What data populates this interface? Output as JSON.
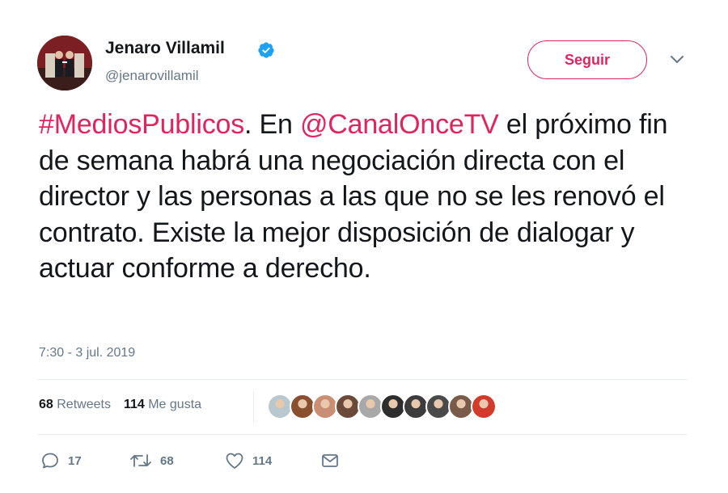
{
  "author": {
    "name": "Jenaro Villamil",
    "handle": "@jenarovillamil",
    "verified": true,
    "avatar_icon": "avatar-photo"
  },
  "follow_button": {
    "label": "Seguir",
    "color": "#e0245e"
  },
  "tweet": {
    "segments": [
      {
        "text": "#MediosPublicos",
        "type": "hashtag"
      },
      {
        "text": ". En ",
        "type": "text"
      },
      {
        "text": "@CanalOnceTV",
        "type": "mention"
      },
      {
        "text": " el próximo fin de semana habrá una negociación directa con el director y las personas a las que no se les renovó el contrato. Existe la mejor disposición de dialogar y actuar conforme a derecho.",
        "type": "text"
      }
    ],
    "timestamp": "7:30 - 3 jul. 2019"
  },
  "stats": {
    "retweets_count": "68",
    "retweets_label": "Retweets",
    "likes_count": "114",
    "likes_label": "Me gusta"
  },
  "likers": [
    {
      "icon": "liker-avatar-1",
      "color": "#b9c7cf"
    },
    {
      "icon": "liker-avatar-2",
      "color": "#8a4f2e"
    },
    {
      "icon": "liker-avatar-3",
      "color": "#c98e73"
    },
    {
      "icon": "liker-avatar-4",
      "color": "#6b4a3a"
    },
    {
      "icon": "liker-avatar-5",
      "color": "#a8a8a8"
    },
    {
      "icon": "liker-avatar-6",
      "color": "#2d2d2d"
    },
    {
      "icon": "liker-avatar-7",
      "color": "#3c3c3c"
    },
    {
      "icon": "liker-avatar-8",
      "color": "#4a4a4a"
    },
    {
      "icon": "liker-avatar-9",
      "color": "#7a5a48"
    },
    {
      "icon": "liker-avatar-10",
      "color": "#d23b2b"
    }
  ],
  "actions": {
    "reply": {
      "icon": "reply-icon",
      "count": "17"
    },
    "retweet": {
      "icon": "retweet-icon",
      "count": "68"
    },
    "like": {
      "icon": "heart-icon",
      "count": "114"
    },
    "message": {
      "icon": "envelope-icon"
    }
  },
  "colors": {
    "accent": "#e0245e",
    "muted": "#657786",
    "text": "#14171a",
    "verified": "#1da1f2"
  }
}
